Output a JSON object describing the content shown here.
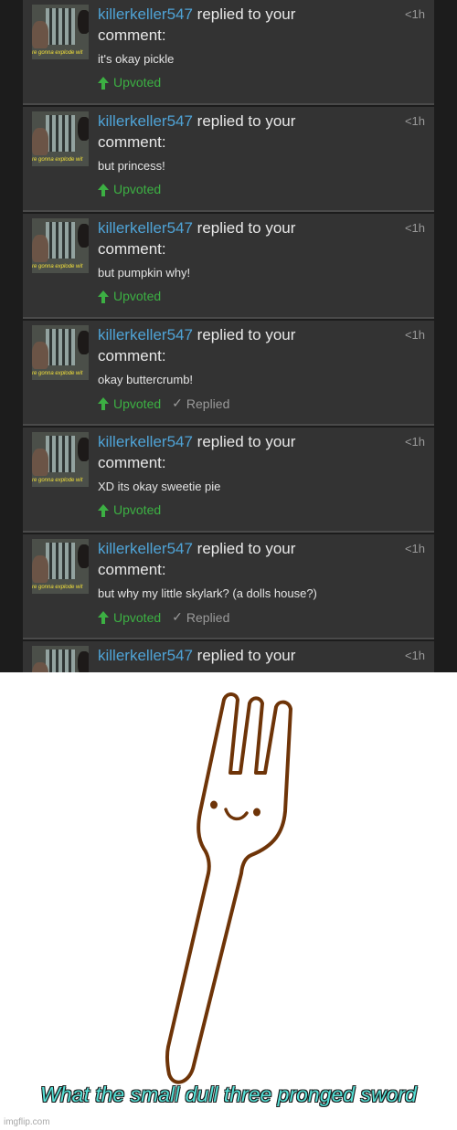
{
  "notifications": [
    {
      "user": "killerkeller547",
      "action": "replied to your",
      "action2": "comment:",
      "time": "<1h",
      "text": "it's okay pickle",
      "upvoted": "Upvoted",
      "replied": ""
    },
    {
      "user": "killerkeller547",
      "action": "replied to your",
      "action2": "comment:",
      "time": "<1h",
      "text": "but princess!",
      "upvoted": "Upvoted",
      "replied": ""
    },
    {
      "user": "killerkeller547",
      "action": "replied to your",
      "action2": "comment:",
      "time": "<1h",
      "text": "but pumpkin why!",
      "upvoted": "Upvoted",
      "replied": ""
    },
    {
      "user": "killerkeller547",
      "action": "replied to your",
      "action2": "comment:",
      "time": "<1h",
      "text": "okay buttercrumb!",
      "upvoted": "Upvoted",
      "replied": "Replied"
    },
    {
      "user": "killerkeller547",
      "action": "replied to your",
      "action2": "comment:",
      "time": "<1h",
      "text": "XD its okay sweetie pie",
      "upvoted": "Upvoted",
      "replied": ""
    },
    {
      "user": "killerkeller547",
      "action": "replied to your",
      "action2": "comment:",
      "time": "<1h",
      "text": "but why my little skylark? (a dolls house?)",
      "upvoted": "Upvoted",
      "replied": "Replied"
    },
    {
      "user": "killerkeller547",
      "action": "replied to your",
      "action2": "",
      "time": "<1h",
      "text": "",
      "upvoted": "",
      "replied": ""
    }
  ],
  "avatar_caption": "re gonna explode wit",
  "meme": {
    "caption": "What the small dull three pronged sword",
    "watermark": "imgflip.com"
  },
  "icons": {
    "upvote": "upvote-arrow-icon",
    "replied": "check-icon"
  },
  "colors": {
    "username": "#4fa3d6",
    "upvoted": "#3cb043",
    "fork": "#6e3408",
    "caption": "#55e0d6"
  }
}
